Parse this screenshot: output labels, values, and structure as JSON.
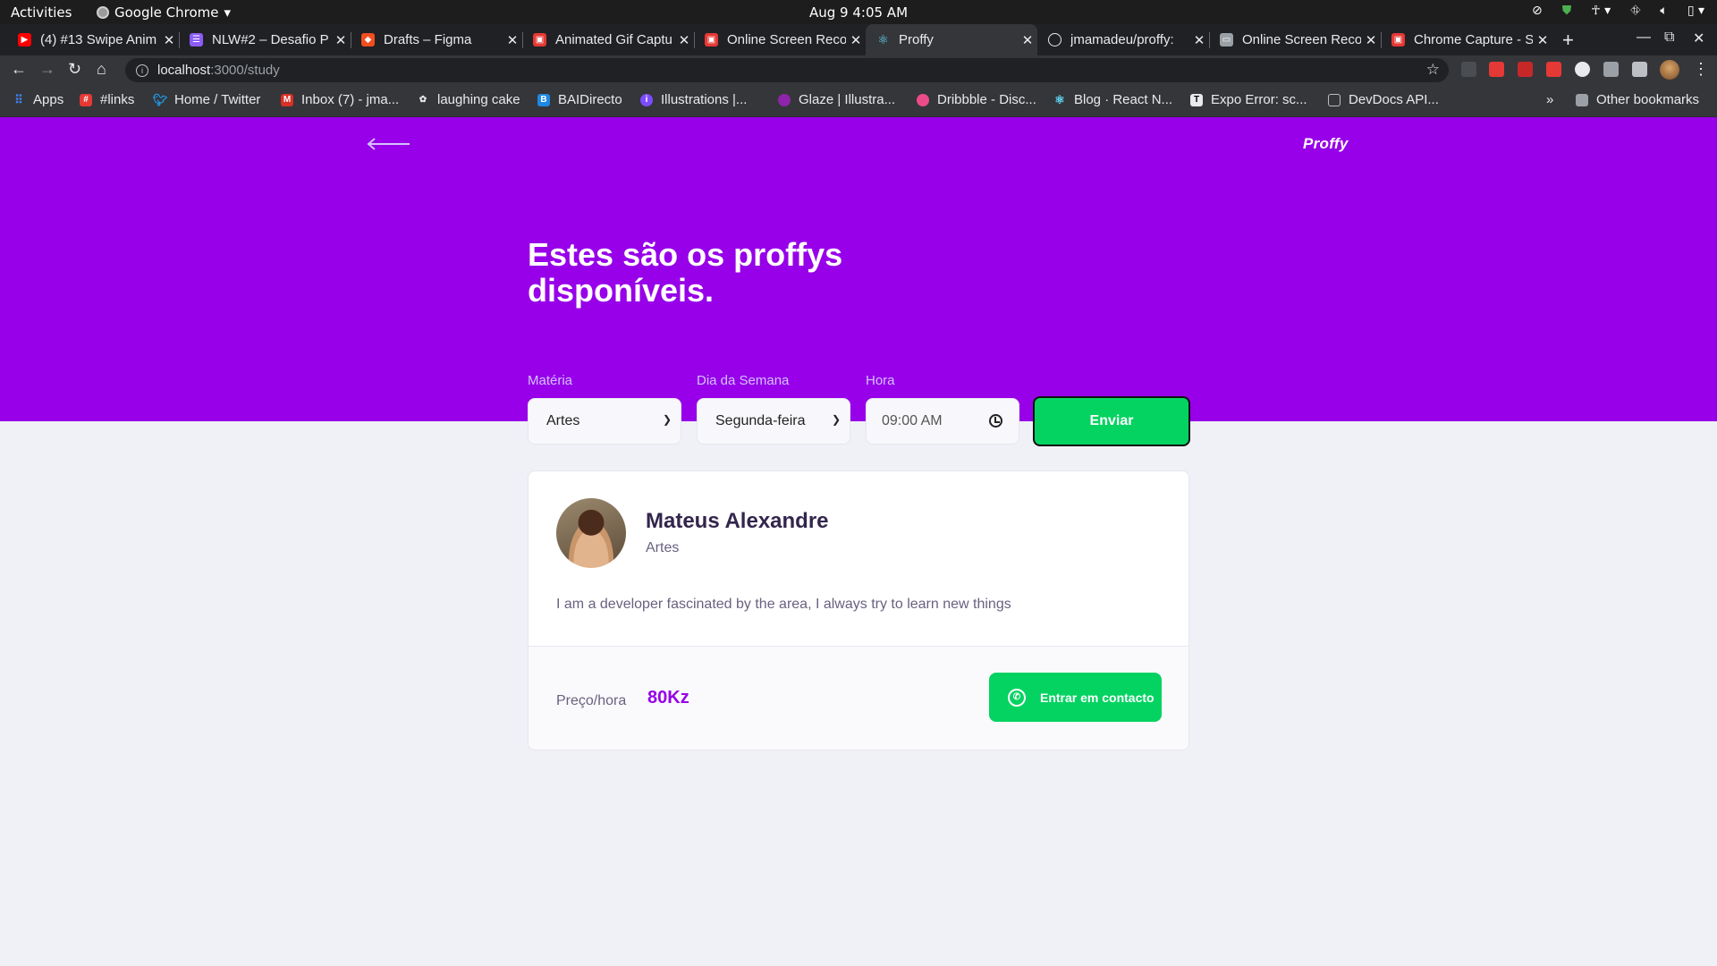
{
  "system_bar": {
    "activities": "Activities",
    "app_name": "Google Chrome",
    "clock": "Aug 9  4:05 AM"
  },
  "tabs": [
    {
      "title": "(4) #13 Swipe Anim",
      "color": "#ff0000"
    },
    {
      "title": "NLW#2 – Desafio P",
      "color": "#8b5cf6"
    },
    {
      "title": "Drafts – Figma",
      "color": "#f24e1e"
    },
    {
      "title": "Animated Gif Captu",
      "color": "#e53935"
    },
    {
      "title": "Online Screen Reco",
      "color": "#e53935"
    },
    {
      "title": "Proffy",
      "color": "#61dafb"
    },
    {
      "title": "jmamadeu/proffy:",
      "color": "#ffffff"
    },
    {
      "title": "Online Screen Reco",
      "color": "#9aa0a6"
    },
    {
      "title": "Chrome Capture - S",
      "color": "#e53935"
    }
  ],
  "address_bar": {
    "host": "localhost",
    "path": ":3000/study"
  },
  "bookmarks": [
    {
      "label": "Apps",
      "color": "#4285f4"
    },
    {
      "label": "#links",
      "color": "#e53935"
    },
    {
      "label": "Home / Twitter",
      "color": "#1da1f2"
    },
    {
      "label": "Inbox (7) - jma...",
      "color": "#d93025"
    },
    {
      "label": "laughing cake",
      "color": "#bdbdbd"
    },
    {
      "label": "BAIDirecto",
      "color": "#1e88e5"
    },
    {
      "label": "Illustrations |...",
      "color": "#7c4dff"
    },
    {
      "label": "Glaze | Illustra...",
      "color": "#8e24aa"
    },
    {
      "label": "Dribbble - Disc...",
      "color": "#ea4c89"
    },
    {
      "label": "Blog · React N...",
      "color": "#61dafb"
    },
    {
      "label": "Expo Error: sc...",
      "color": "#000000"
    },
    {
      "label": "DevDocs API...",
      "color": "#bdbdbd"
    }
  ],
  "other_bookmarks": "Other bookmarks",
  "page": {
    "brand": "Proffy",
    "title": "Estes são os proffys disponíveis.",
    "filters": {
      "subject_label": "Matéria",
      "subject_value": "Artes",
      "weekday_label": "Dia da Semana",
      "weekday_value": "Segunda-feira",
      "time_label": "Hora",
      "time_value": "09:00  AM",
      "submit": "Enviar"
    },
    "teacher": {
      "name": "Mateus Alexandre",
      "subject": "Artes",
      "bio": "I am a developer fascinated by the area, I always try to learn new things",
      "price_label": "Preço/hora",
      "price": "80Kz",
      "contact_button": "Entrar em contacto"
    }
  },
  "colors": {
    "primary": "#9700e9",
    "secondary": "#04d361",
    "background": "#f0f0f7"
  }
}
